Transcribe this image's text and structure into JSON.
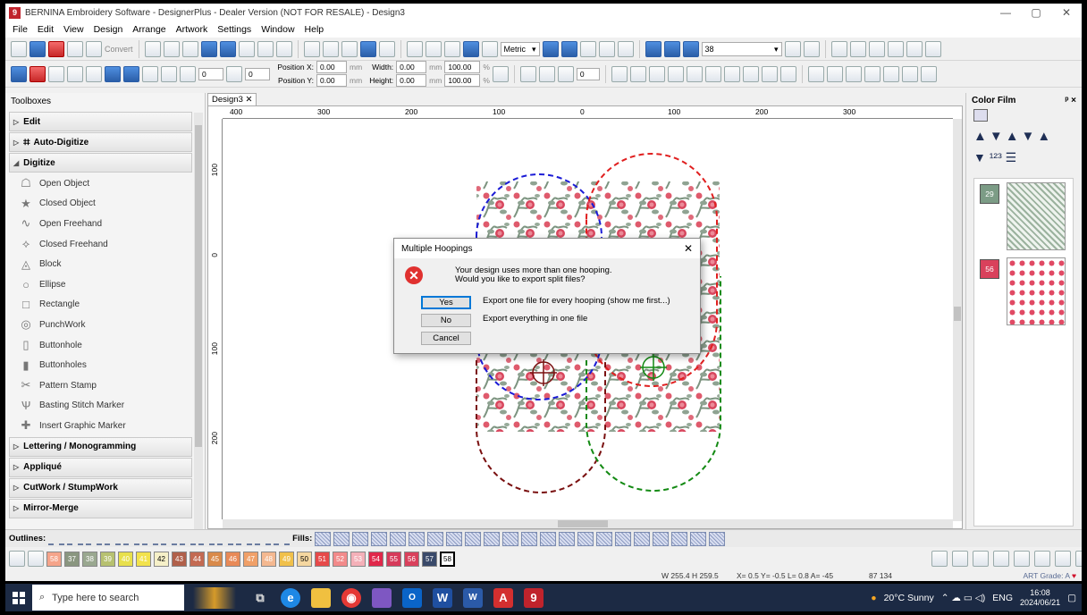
{
  "window": {
    "title": "BERNINA Embroidery Software - DesignerPlus - Dealer Version (NOT FOR RESALE) - Design3",
    "logo_text": "9"
  },
  "menu": [
    "File",
    "Edit",
    "View",
    "Design",
    "Arrange",
    "Artwork",
    "Settings",
    "Window",
    "Help"
  ],
  "toolbar1": {
    "convert_label": "Convert",
    "metric_label": "Metric",
    "zoom_value": "38"
  },
  "toolbar2": {
    "position_x_label": "Position X:",
    "position_y_label": "Position Y:",
    "position_x": "0.00",
    "position_y": "0.00",
    "width_label": "Width:",
    "height_label": "Height:",
    "width": "0.00",
    "height": "0.00",
    "scale_w": "100.00",
    "scale_h": "100.00",
    "unit_mm": "mm",
    "unit_pct": "%",
    "rotate_value": "0",
    "angle_value": "0"
  },
  "toolbox": {
    "title": "Toolboxes",
    "sections": {
      "edit": "Edit",
      "auto_digitize": "Auto-Digitize",
      "digitize": "Digitize",
      "lettering": "Lettering / Monogramming",
      "applique": "Appliqué",
      "cutwork": "CutWork / StumpWork",
      "mirror_merge": "Mirror-Merge"
    },
    "tools": [
      {
        "label": "Open Object",
        "icon": "open-object-icon"
      },
      {
        "label": "Closed Object",
        "icon": "closed-object-icon"
      },
      {
        "label": "Open Freehand",
        "icon": "open-freehand-icon"
      },
      {
        "label": "Closed Freehand",
        "icon": "closed-freehand-icon"
      },
      {
        "label": "Block",
        "icon": "block-icon"
      },
      {
        "label": "Ellipse",
        "icon": "ellipse-icon"
      },
      {
        "label": "Rectangle",
        "icon": "rectangle-icon"
      },
      {
        "label": "PunchWork",
        "icon": "punchwork-icon"
      },
      {
        "label": "Buttonhole",
        "icon": "buttonhole-icon"
      },
      {
        "label": "Buttonholes",
        "icon": "buttonholes-icon"
      },
      {
        "label": "Pattern Stamp",
        "icon": "pattern-stamp-icon"
      },
      {
        "label": "Basting Stitch Marker",
        "icon": "basting-stitch-icon"
      },
      {
        "label": "Insert Graphic Marker",
        "icon": "graphic-marker-icon"
      }
    ]
  },
  "document": {
    "tab_label": "Design3",
    "ruler_h": [
      "400",
      "300",
      "200",
      "100",
      "0",
      "100",
      "200",
      "300"
    ],
    "ruler_v": [
      "100",
      "0",
      "100",
      "200"
    ]
  },
  "dialog": {
    "title": "Multiple Hoopings",
    "message_line1": "Your design uses more than one hooping.",
    "message_line2": "Would you like to export split files?",
    "yes_label": "Yes",
    "no_label": "No",
    "cancel_label": "Cancel",
    "yes_desc": "Export one file for every hooping  (show me first...)",
    "no_desc": "Export everything in one file"
  },
  "color_film": {
    "title": "Color Film",
    "pin": "! ×",
    "items": [
      {
        "number": "29",
        "color": "#7c9c86"
      },
      {
        "number": "56",
        "color": "#d9415c"
      }
    ]
  },
  "outlines_bar": {
    "outlines_label": "Outlines:",
    "fills_label": "Fills:"
  },
  "palette": [
    {
      "n": "58",
      "c": "#f5a48a"
    },
    {
      "n": "37",
      "c": "#8a9680"
    },
    {
      "n": "38",
      "c": "#9aa890"
    },
    {
      "n": "39",
      "c": "#b7c170"
    },
    {
      "n": "40",
      "c": "#e8e04c"
    },
    {
      "n": "41",
      "c": "#f2e24c"
    },
    {
      "n": "42",
      "c": "#f6f0c8"
    },
    {
      "n": "43",
      "c": "#b0604a"
    },
    {
      "n": "44",
      "c": "#c36a52"
    },
    {
      "n": "45",
      "c": "#d98a4a"
    },
    {
      "n": "46",
      "c": "#e88a58"
    },
    {
      "n": "47",
      "c": "#f0a068"
    },
    {
      "n": "48",
      "c": "#f4b890"
    },
    {
      "n": "49",
      "c": "#f0c04a"
    },
    {
      "n": "50",
      "c": "#f5d7a0"
    },
    {
      "n": "51",
      "c": "#e64a4a"
    },
    {
      "n": "52",
      "c": "#f28a8a"
    },
    {
      "n": "53",
      "c": "#f4b0b8"
    },
    {
      "n": "54",
      "c": "#e0284a"
    },
    {
      "n": "55",
      "c": "#d63a5a"
    },
    {
      "n": "56",
      "c": "#d9415c"
    },
    {
      "n": "57",
      "c": "#3a4a6a"
    },
    {
      "n": "58",
      "c": "#ffffff"
    }
  ],
  "status": {
    "dims": "W 255.4 H 259.5",
    "coords": "X=  0.5 Y=  -0.5 L=  0.8 A= -45",
    "stitches": "87 134",
    "art_grade": "ART Grade: A"
  },
  "taskbar": {
    "search_placeholder": "Type here to search",
    "weather": "20°C  Sunny",
    "lang": "ENG",
    "time": "16:08",
    "date": "2024/06/21"
  }
}
